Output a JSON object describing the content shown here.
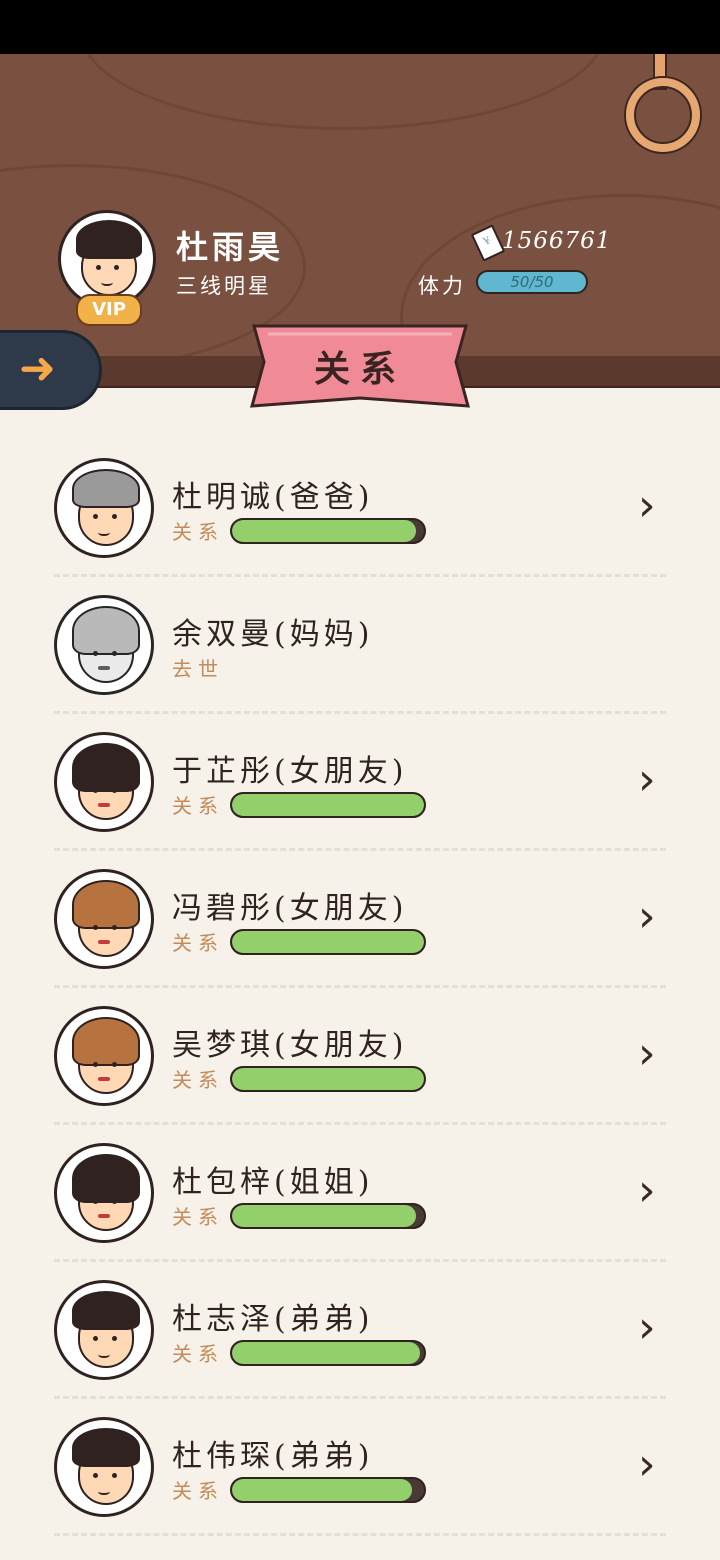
{
  "player": {
    "name": "杜雨昊",
    "title": "三线明星",
    "vip": "VIP",
    "money": "1566761",
    "stamina_label": "体力",
    "stamina": "50/50"
  },
  "page_title": "关系",
  "icons": {
    "back": "back-arrow-icon",
    "money": "money-note-icon",
    "chevron": "chevron-right-icon"
  },
  "colors": {
    "header": "#7a5140",
    "ribbon": "#f08a96",
    "bar_fill": "#93cf6b",
    "stamina": "#5fb8cf",
    "rel_label": "#c48b5a"
  },
  "relations": [
    {
      "name": "杜明诚(爸爸)",
      "status": "关系",
      "level": 0.96,
      "deceased": false,
      "hair": "#9a9a9a"
    },
    {
      "name": "余双曼(妈妈)",
      "status": "去世",
      "level": null,
      "deceased": true,
      "hair": "#b0b0b0"
    },
    {
      "name": "于芷彤(女朋友)",
      "status": "关系",
      "level": 1.0,
      "deceased": false,
      "hair": "#2f2220"
    },
    {
      "name": "冯碧彤(女朋友)",
      "status": "关系",
      "level": 1.0,
      "deceased": false,
      "hair": "#b7733f"
    },
    {
      "name": "吴梦琪(女朋友)",
      "status": "关系",
      "level": 1.0,
      "deceased": false,
      "hair": "#b7733f"
    },
    {
      "name": "杜包梓(姐姐)",
      "status": "关系",
      "level": 0.96,
      "deceased": false,
      "hair": "#2f2220"
    },
    {
      "name": "杜志泽(弟弟)",
      "status": "关系",
      "level": 0.98,
      "deceased": false,
      "hair": "#2f2220"
    },
    {
      "name": "杜伟琛(弟弟)",
      "status": "关系",
      "level": 0.94,
      "deceased": false,
      "hair": "#2f2220"
    }
  ]
}
